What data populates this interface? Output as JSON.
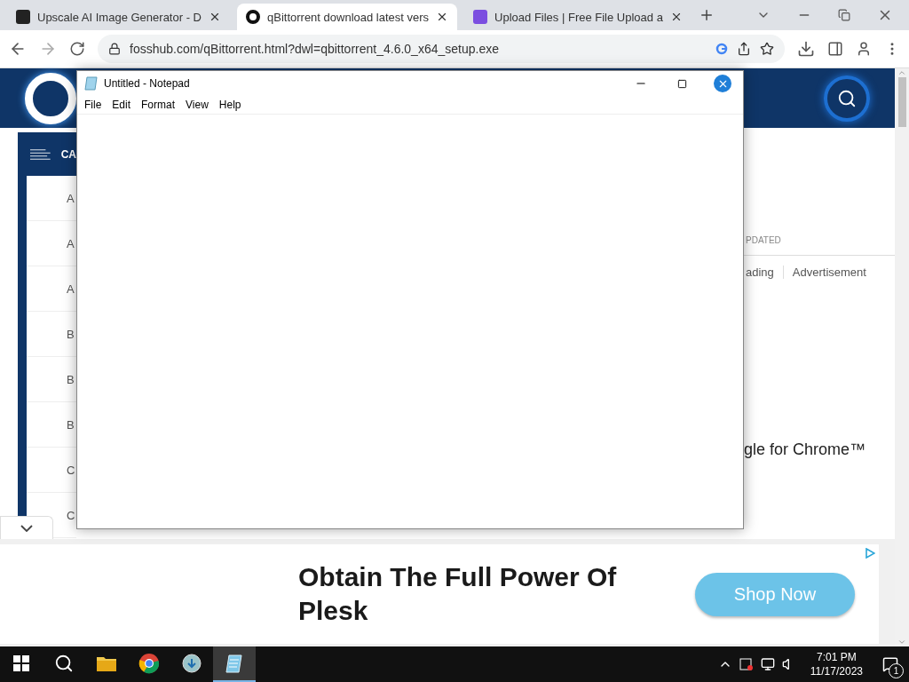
{
  "browser": {
    "tabs": [
      {
        "title": "Upscale AI Image Generator - D",
        "selected": false,
        "kind": "upscale"
      },
      {
        "title": "qBittorrent download latest vers",
        "selected": true,
        "kind": "fosshub"
      },
      {
        "title": "Upload Files | Free File Upload a",
        "selected": false,
        "kind": "upload"
      }
    ],
    "url": "fosshub.com/qBittorrent.html?dwl=qbittorrent_4.6.0_x64_setup.exe"
  },
  "page": {
    "sidebar": {
      "heading": "CA",
      "items": [
        "A",
        "A",
        "A",
        "B",
        "B",
        "B",
        "C",
        "C"
      ]
    },
    "column_header": "PDATED",
    "tabs": [
      {
        "label": "ading",
        "selected": false
      },
      {
        "label": "Advertisement",
        "selected": false
      }
    ],
    "promo": "gle for Chrome™"
  },
  "ad": {
    "headline": "Obtain The Full Power Of Plesk",
    "button": "Shop Now"
  },
  "notepad": {
    "title": "Untitled - Notepad",
    "menu": [
      "File",
      "Edit",
      "Format",
      "View",
      "Help"
    ]
  },
  "taskbar": {
    "apps": [
      {
        "kind": "folder",
        "selected": false
      },
      {
        "kind": "chrome",
        "selected": false
      },
      {
        "kind": "installer",
        "selected": false
      },
      {
        "kind": "notepad",
        "selected": true
      }
    ],
    "time": "7:01 PM",
    "date": "11/17/2023",
    "notifications": "1"
  }
}
